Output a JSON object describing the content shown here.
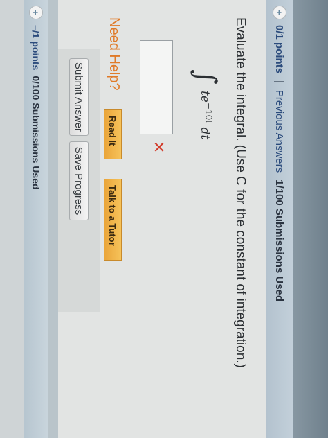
{
  "question": {
    "points": "0/1 points",
    "separator": "|",
    "previous_answers": "Previous Answers",
    "submissions": "1/100 Submissions Used",
    "prompt": "Evaluate the integral. (Use C for the constant of integration.)",
    "integral_sign": "∫",
    "integrand_base": "te",
    "integrand_exponent": "−10t",
    "integrand_dt": "dt",
    "answer_value": "",
    "status_icon": "✕",
    "need_help": "Need Help?",
    "read_it": "Read It",
    "talk_to_tutor": "Talk to a Tutor",
    "submit_answer": "Submit Answer",
    "save_progress": "Save Progress"
  },
  "next_question": {
    "points": "–/1 points",
    "submissions": "0/100 Submissions Used"
  },
  "icons": {
    "plus": "+",
    "wrong": "x-mark-icon"
  },
  "colors": {
    "need_help": "#e07a28",
    "wrong": "#d23b2a",
    "help_button": "#eaa53a",
    "link": "#2b4b7c"
  }
}
